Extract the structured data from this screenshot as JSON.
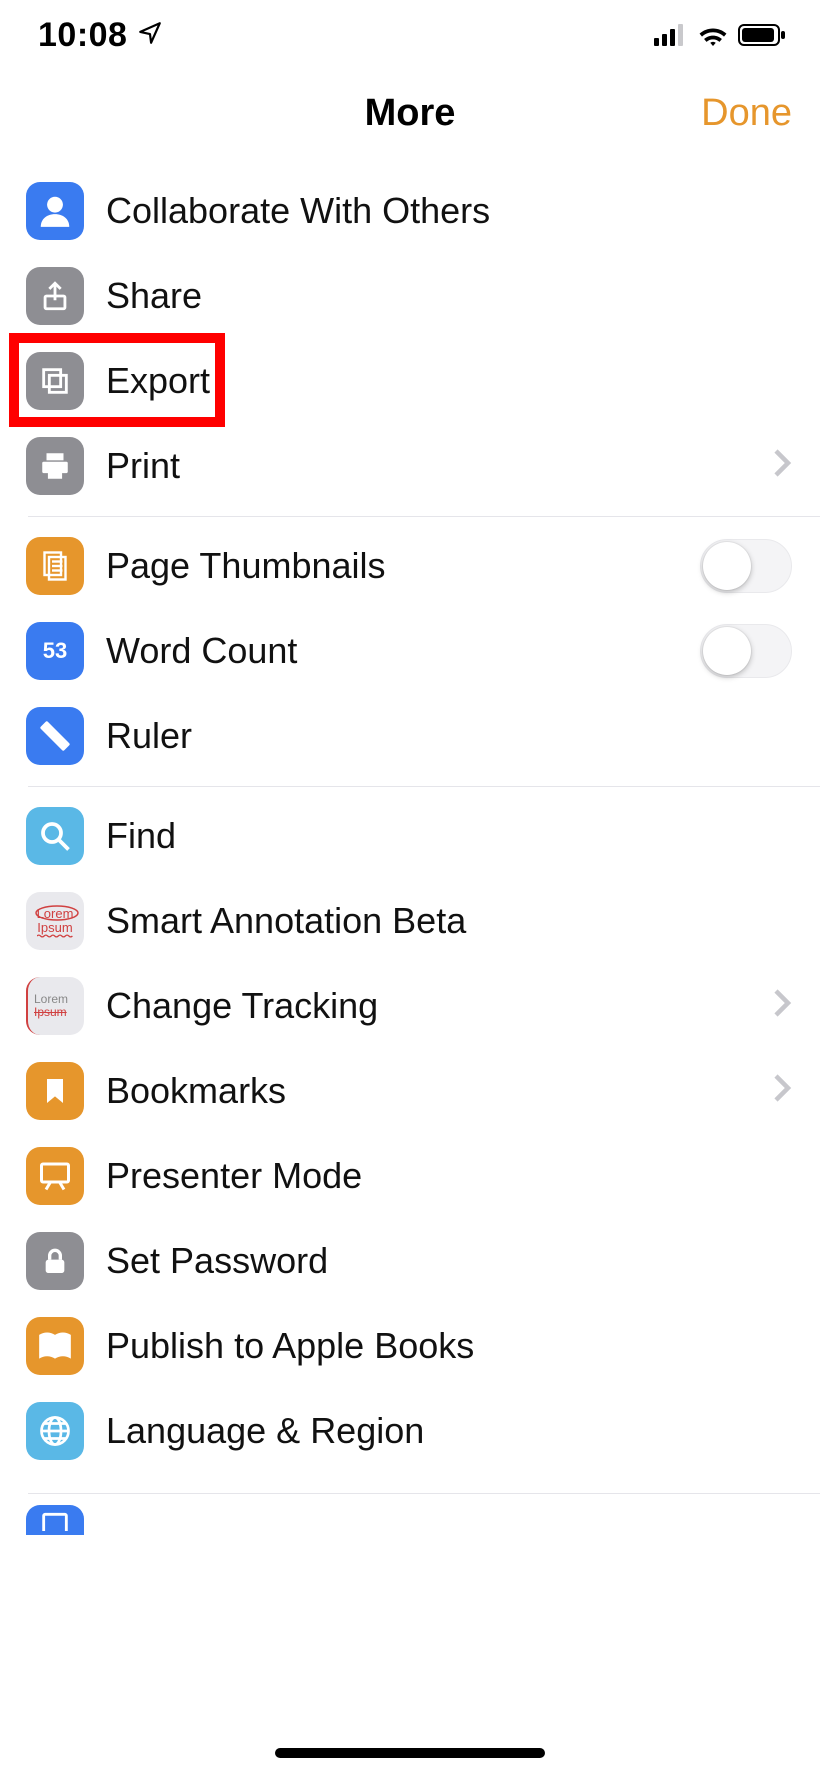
{
  "status": {
    "time": "10:08"
  },
  "header": {
    "title": "More",
    "done": "Done"
  },
  "group1": {
    "collaborate": "Collaborate With Others",
    "share": "Share",
    "export": "Export",
    "print": "Print"
  },
  "group2": {
    "thumbnails": "Page Thumbnails",
    "wordcount_label": "Word Count",
    "wordcount_value": "53",
    "ruler": "Ruler"
  },
  "group3": {
    "find": "Find",
    "smart_annotation": "Smart Annotation Beta",
    "change_tracking": "Change Tracking",
    "bookmarks": "Bookmarks",
    "presenter_mode": "Presenter Mode",
    "set_password": "Set Password",
    "publish_books": "Publish to Apple Books",
    "language_region": "Language & Region"
  }
}
